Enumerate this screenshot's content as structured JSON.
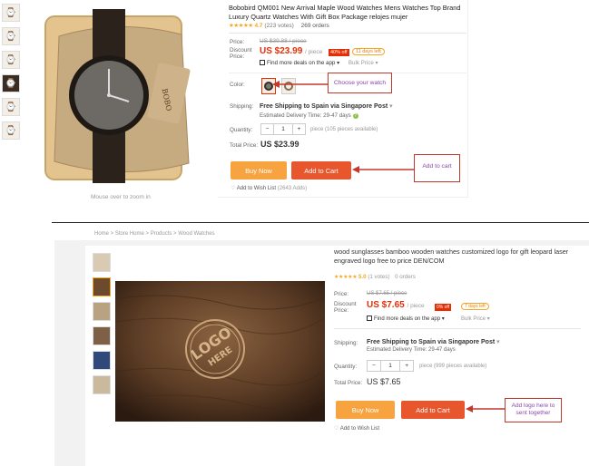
{
  "top": {
    "title": "Bobobird QM001 New Arrival Maple Wood Watches Mens Watches Top Brand Luxury Quartz Watches With Gift Box Package relojes mujer",
    "rating_value": "4.7",
    "rating_votes": "(223 votes)",
    "orders": "269 orders",
    "price_label": "Price:",
    "price_original": "US $39.88 / piece",
    "discount_label": "Discount Price:",
    "discount_price": "US $23.99",
    "discount_unit": "/ piece",
    "off_badge": "40% off",
    "days_badge": "11 days left",
    "deals_text": "Find more deals on the app",
    "bulk_text": "Bulk Price",
    "color_label": "Color:",
    "callout_watch": "Choose your watch",
    "shipping_label": "Shipping:",
    "shipping_text": "Free Shipping to Spain via Singapore Post",
    "estimated": "Estimated Delivery Time: 29-47 days",
    "quantity_label": "Quantity:",
    "quantity_value": "1",
    "qty_minus": "−",
    "qty_plus": "+",
    "quantity_avail": "piece (105 pieces available)",
    "total_label": "Total Price:",
    "total_price": "US $23.99",
    "buy_now": "Buy Now",
    "add_to_cart": "Add to Cart",
    "callout_cart": "Add to cart",
    "wishlist": "Add to Wish List",
    "wishlist_count": "(2643 Adds)",
    "zoom_hint": "Mouse over to zoom in"
  },
  "bottom": {
    "breadcrumb": "Home > Store Home > Products > Wood Watches",
    "title": "wood sunglasses bamboo wooden watches customized logo for gift leopard laser engraved logo free to price DEN/COM",
    "rating_value": "5.0",
    "rating_votes": "(1 votes)",
    "orders": "0 orders",
    "price_label": "Price:",
    "price_original": "US $7.65 / piece",
    "discount_label": "Discount Price:",
    "discount_price": "US $7.65",
    "discount_unit": "/ piece",
    "off_badge": "0% off",
    "days_badge": "7 days left",
    "deals_text": "Find more deals on the app",
    "bulk_text": "Bulk Price",
    "shipping_label": "Shipping:",
    "shipping_text": "Free Shipping to Spain via Singapore Post",
    "estimated": "Estimated Delivery Time: 29-47 days",
    "quantity_label": "Quantity:",
    "quantity_value": "1",
    "qty_minus": "−",
    "qty_plus": "+",
    "quantity_avail": "piece (999 pieces available)",
    "total_label": "Total Price:",
    "total_price": "US $7.65",
    "buy_now": "Buy Now",
    "add_to_cart": "Add to Cart",
    "callout_logo": "Add logo here to sent together",
    "wishlist": "Add to Wish List",
    "logo_line1": "LOGO",
    "logo_line2": "HERE"
  },
  "colors": {
    "accent_red": "#e62e04",
    "buy_orange": "#f7a440",
    "cart_orange": "#e8562e",
    "callout_border": "#c0392b",
    "callout_text": "#8e44ad"
  }
}
